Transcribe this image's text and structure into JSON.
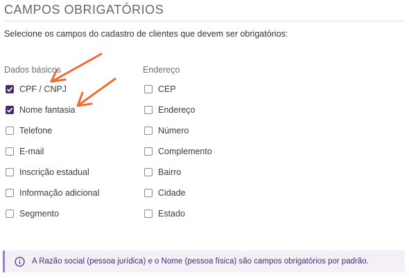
{
  "section": {
    "title": "CAMPOS OBRIGATÓRIOS",
    "subtitle": "Selecione os campos do cadastro de clientes que devem ser obrigatórios:"
  },
  "basic": {
    "heading": "Dados básicos",
    "items": [
      {
        "label": "CPF / CNPJ",
        "checked": true
      },
      {
        "label": "Nome fantasia",
        "checked": true
      },
      {
        "label": "Telefone",
        "checked": false
      },
      {
        "label": "E-mail",
        "checked": false
      },
      {
        "label": "Inscrição estadual",
        "checked": false
      },
      {
        "label": "Informação adicional",
        "checked": false
      },
      {
        "label": "Segmento",
        "checked": false
      }
    ]
  },
  "address": {
    "heading": "Endereço",
    "items": [
      {
        "label": "CEP",
        "checked": false
      },
      {
        "label": "Endereço",
        "checked": false
      },
      {
        "label": "Número",
        "checked": false
      },
      {
        "label": "Complemento",
        "checked": false
      },
      {
        "label": "Bairro",
        "checked": false
      },
      {
        "label": "Cidade",
        "checked": false
      },
      {
        "label": "Estado",
        "checked": false
      }
    ]
  },
  "info": {
    "text": "A Razão social (pessoa jurídica) e o Nome (pessoa física) são campos obrigatórios por padrão.",
    "icon": "info-circle-icon"
  },
  "colors": {
    "accent": "#4b2a6e",
    "annotation_arrow": "#f26a2e",
    "info_bg": "#f4f0f8",
    "info_border": "#a07ec4"
  }
}
